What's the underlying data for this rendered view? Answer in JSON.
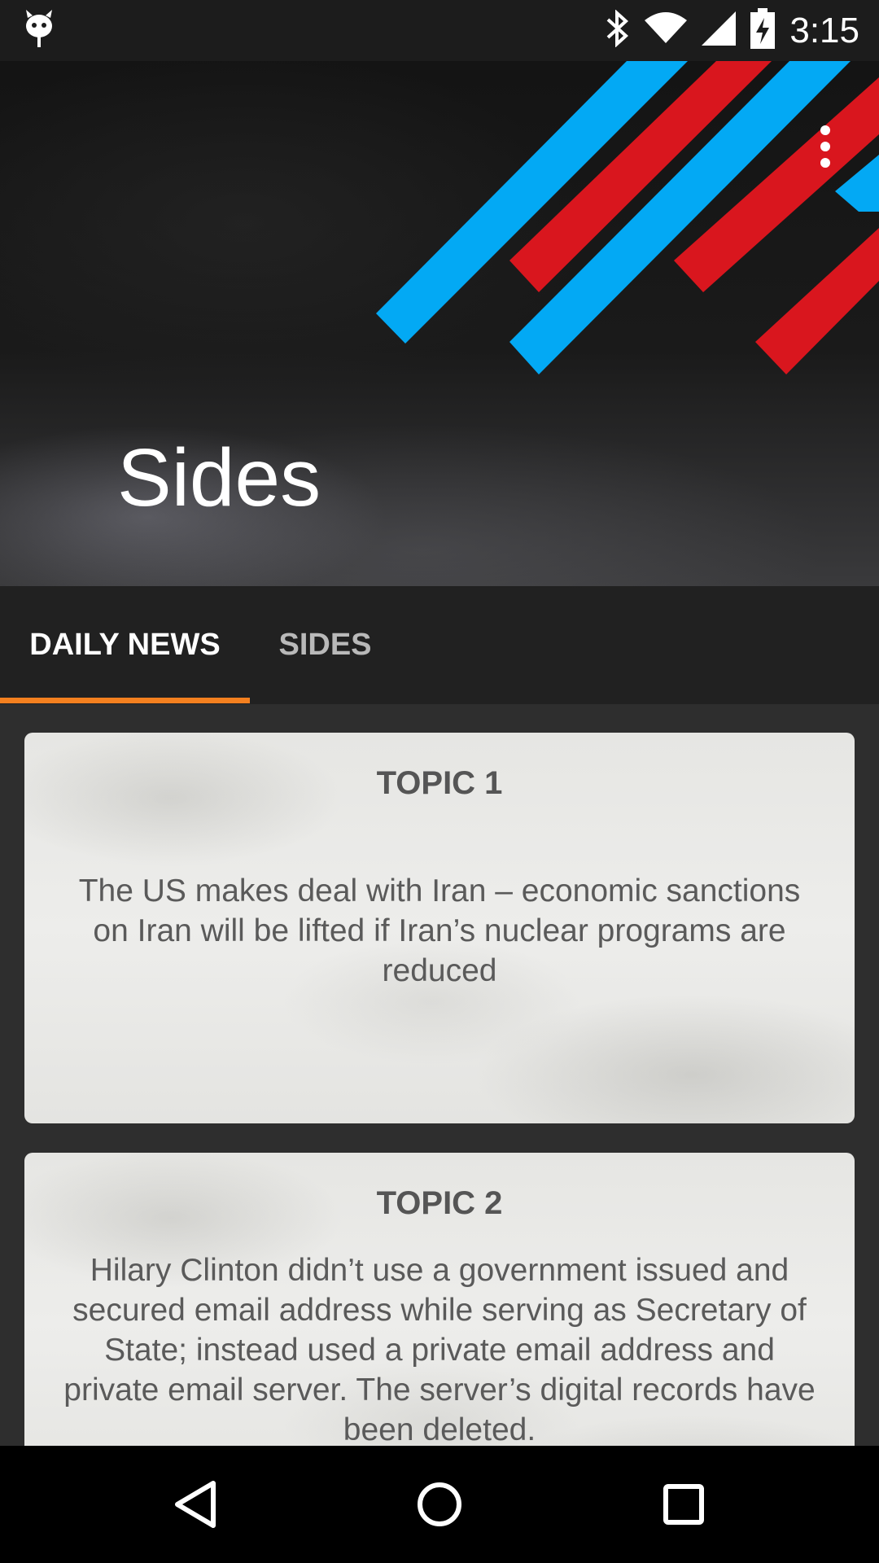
{
  "status_bar": {
    "time": "3:15",
    "icons": [
      "android-debug-icon",
      "bluetooth-icon",
      "wifi-icon",
      "cell-signal-icon",
      "battery-charging-icon"
    ]
  },
  "header": {
    "title": "Sides",
    "overflow_icon": "more-vert-icon",
    "stripe_colors": {
      "blue": "#03a9f4",
      "red": "#d9161e"
    }
  },
  "tabs": [
    {
      "label": "DAILY NEWS",
      "selected": true
    },
    {
      "label": "SIDES",
      "selected": false
    }
  ],
  "accent": "#f4801f",
  "cards": [
    {
      "title": "TOPIC 1",
      "body": "The US makes deal with Iran – economic sanctions on Iran will be lifted if Iran’s nuclear programs are reduced"
    },
    {
      "title": "TOPIC 2",
      "body": "Hilary Clinton didn’t use a government issued and secured email address while serving as Secretary of State; instead used a private email address and private email server.  The server’s digital records have been deleted."
    }
  ],
  "nav": {
    "back_icon": "back-triangle-icon",
    "home_icon": "home-circle-icon",
    "recents_icon": "recents-square-icon"
  }
}
